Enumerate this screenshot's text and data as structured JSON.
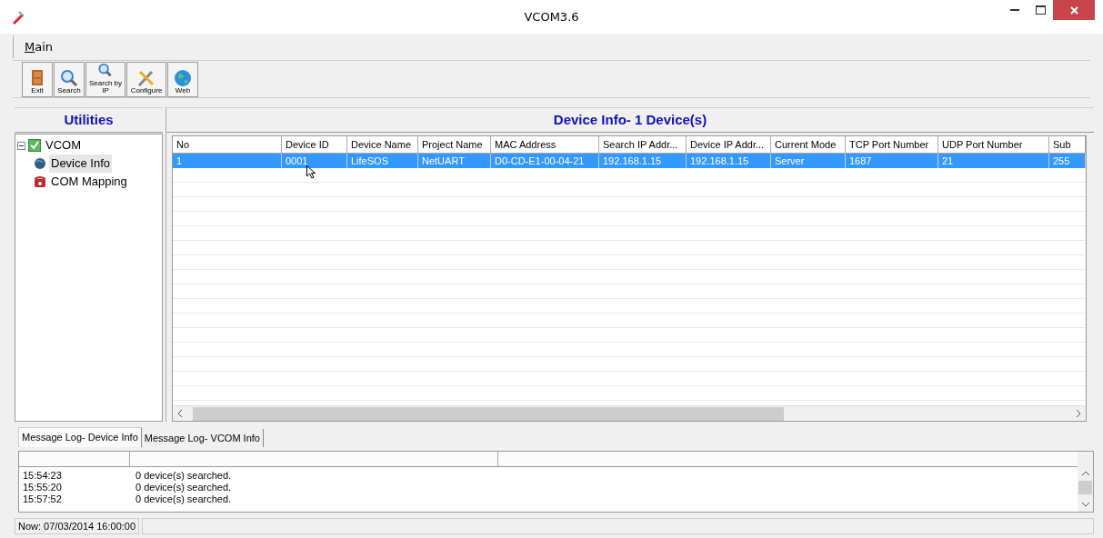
{
  "window": {
    "title": "VCOM3.6"
  },
  "menu": [
    {
      "label": "Main"
    }
  ],
  "toolbar": [
    {
      "label": "Exit",
      "kind": "exit"
    },
    {
      "label": "Search",
      "kind": "search"
    },
    {
      "label": "Search by IP",
      "kind": "search-ip"
    },
    {
      "label": "Configure",
      "kind": "configure"
    },
    {
      "label": "Web",
      "kind": "web"
    }
  ],
  "utilities": {
    "title": "Utilities",
    "tree": [
      {
        "label": "VCOM",
        "kind": "root",
        "expanded": true,
        "selected": false,
        "children": [
          {
            "label": "Device Info",
            "kind": "device",
            "selected": true
          },
          {
            "label": "COM Mapping",
            "kind": "mapping",
            "selected": false
          }
        ]
      }
    ]
  },
  "device_info": {
    "title": "Device Info- 1 Device(s)",
    "columns": [
      "No",
      "Device ID",
      "Device Name",
      "Project Name",
      "MAC Address",
      "Search IP Addr...",
      "Device IP Addr...",
      "Current Mode",
      "TCP Port Number",
      "UDP Port Number",
      "Sub"
    ],
    "rows": [
      {
        "selected": true,
        "cells": [
          "1",
          "0001",
          "LifeSOS",
          "NetUART",
          "D0-CD-E1-00-04-21",
          "192.168.1.15",
          "192.168.1.15",
          "Server",
          "1687",
          "21",
          "255"
        ]
      }
    ]
  },
  "log": {
    "tabs": [
      {
        "label": "Message Log- Device Info",
        "selected": true
      },
      {
        "label": "Message Log- VCOM Info",
        "selected": false
      }
    ],
    "rows": [
      {
        "time": "15:54:23",
        "message": "0 device(s) searched."
      },
      {
        "time": "15:55:20",
        "message": "0 device(s) searched."
      },
      {
        "time": "15:57:52",
        "message": "0 device(s) searched."
      }
    ]
  },
  "status_bar": {
    "text": "Now: 07/03/2014 16:00:00"
  }
}
